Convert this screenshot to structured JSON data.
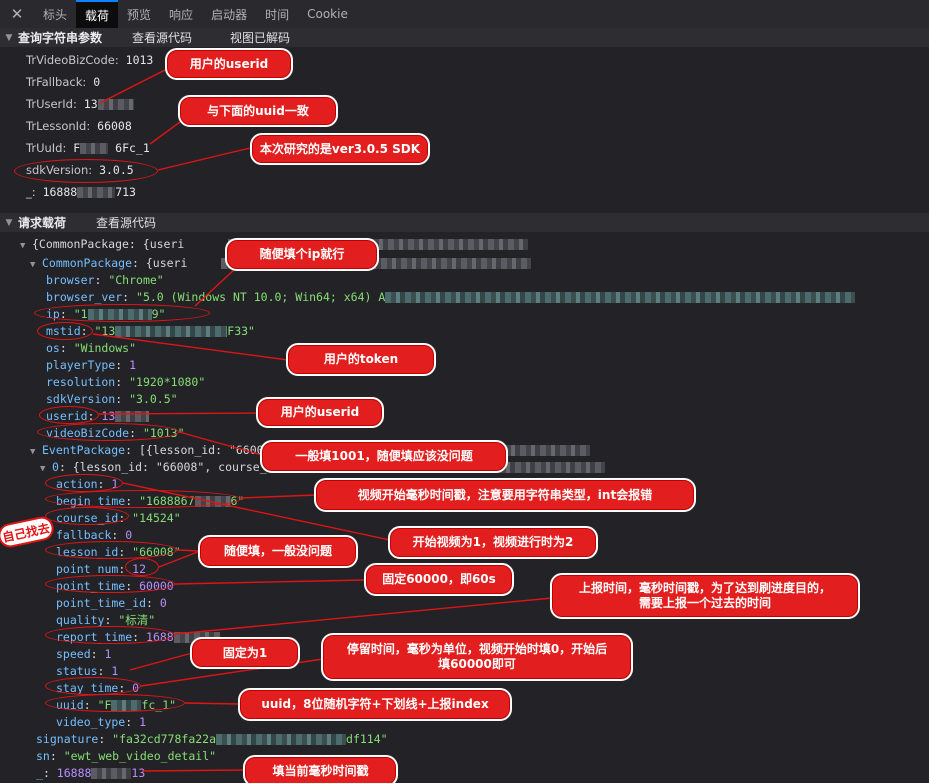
{
  "tabs": [
    {
      "label": "标头"
    },
    {
      "label": "载荷"
    },
    {
      "label": "预览"
    },
    {
      "label": "响应"
    },
    {
      "label": "启动器"
    },
    {
      "label": "时间"
    },
    {
      "label": "Cookie"
    }
  ],
  "close_glyph": "✕",
  "query_section": {
    "title": "查询字符串参数",
    "link1": "查看源代码",
    "link2": "视图已解码"
  },
  "query_params": [
    {
      "key": "TrVideoBizCode:",
      "value": "1013"
    },
    {
      "key": "TrFallback:",
      "value": "0"
    },
    {
      "key": "TrUserId:",
      "value": "13"
    },
    {
      "key": "TrLessonId:",
      "value": "66008"
    },
    {
      "key": "TrUuId:",
      "value": "F",
      "value2": "6Fc_1"
    },
    {
      "key": "sdkVersion:",
      "value": "3.0.5"
    },
    {
      "key": "_:",
      "value": "16888",
      "value2": "713"
    }
  ],
  "payload_section": {
    "title": "请求载荷",
    "link1": "查看源代码"
  },
  "payload": {
    "root_line": "{CommonPackage: {useri",
    "common_line_key": "CommonPackage",
    "common_line_rest": ": {useri",
    "browser": "\"Chrome\"",
    "browser_ver": "\"5.0 (Windows NT 10.0; Win64; x64) A",
    "ip": "\"1",
    "ip_tail": "9\"",
    "mstid": "\"13",
    "mstid_tail": "F33\"",
    "os": "\"Windows\"",
    "playerType": "1",
    "resolution": "\"1920*1080\"",
    "sdkVersion": "\"3.0.5\"",
    "userid": "13",
    "videoBizCode": "\"1013\"",
    "event_line_rest": ": [{lesson_id: \"6600",
    "event0_rest": ": {lesson_id: \"66008\", course_",
    "action": "1",
    "begin_time": "\"1688867",
    "begin_time_tail": "6\"",
    "course_id": "\"14524\"",
    "fallback": "0",
    "lesson_id": "\"66008\"",
    "point_num": "12",
    "point_time": "60000",
    "point_time_id": "0",
    "quality": "\"标清\"",
    "report_time": "1688",
    "speed": "1",
    "status": "1",
    "stay_time": "0",
    "uuid": "\"F",
    "uuid_tail": "fc_1\"",
    "video_type": "1",
    "signature": "\"fa32cd778fa22a",
    "signature_tail": "df114\"",
    "sn": "\"ewt_web_video_detail\"",
    "underscore": "16888",
    "underscore_tail": "13"
  },
  "annotations": {
    "a1": "用户的userid",
    "a2": "与下面的uuid一致",
    "a3": "本次研究的是ver3.0.5 SDK",
    "a4": "随便填个ip就行",
    "a5": "用户的token",
    "a6": "用户的userid",
    "a7": "一般填1001，随便填应该没问题",
    "a8": "视频开始毫秒时间戳，注意要用字符串类型，int会报错",
    "a9": "开始视频为1，视频进行时为2",
    "a10": "随便填，一般没问题",
    "a11": "固定60000，即60s",
    "a12a": "上报时间，毫秒时间戳，为了达到刷进度目的，",
    "a12b": "需要上报一个过去的时间",
    "a13": "固定为1",
    "a14a": "停留时间，毫秒为单位，视频开始时填0，开始后",
    "a14b": "填60000即可",
    "a15": "uuid，8位随机字符+下划线+上报index",
    "a16": "填当前毫秒时间戳",
    "side": "自己找去"
  },
  "colors": {
    "annotation_red": "#e31e1e",
    "key_blue": "#75bfff",
    "string_green": "#86de74",
    "number_purple": "#b98eff"
  }
}
